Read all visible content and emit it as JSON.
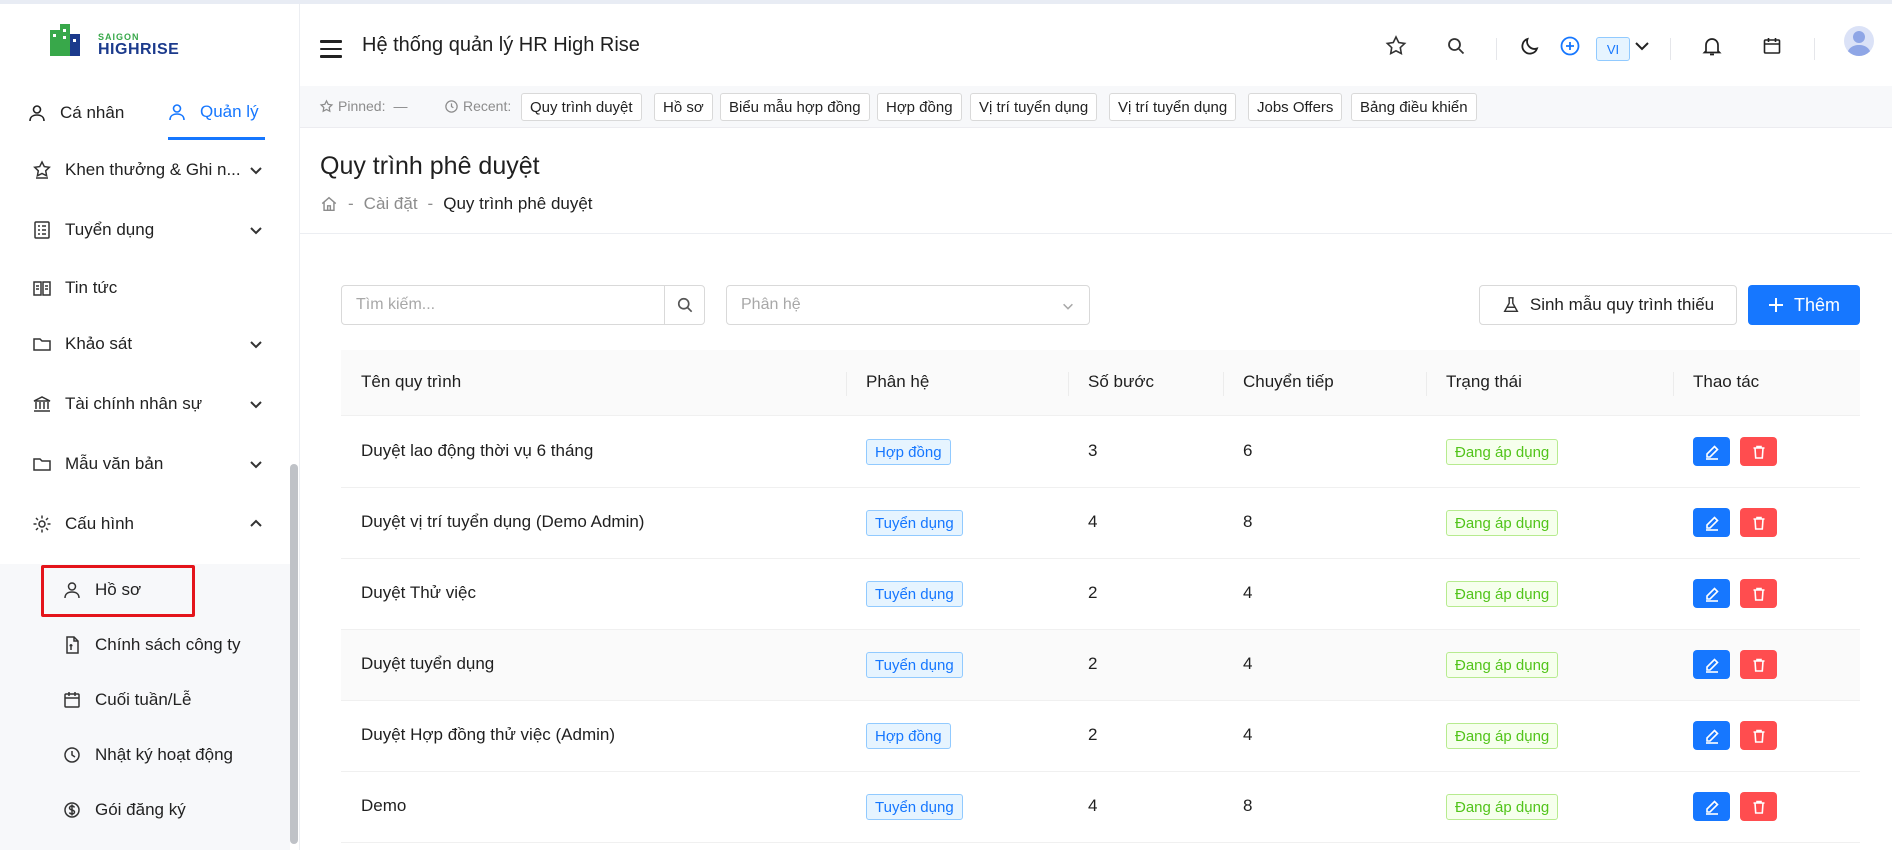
{
  "brand": {
    "top": "SAIGON",
    "main": "HIGHRISE"
  },
  "sidebar": {
    "tabs": [
      {
        "label": "Cá nhân"
      },
      {
        "label": "Quản lý"
      }
    ],
    "items": [
      {
        "label": "Khen thưởng & Ghi n...",
        "icon": "award-icon"
      },
      {
        "label": "Tuyển dụng",
        "icon": "list-icon"
      },
      {
        "label": "Tin tức",
        "icon": "news-icon"
      },
      {
        "label": "Khảo sát",
        "icon": "folder-icon"
      },
      {
        "label": "Tài chính nhân sự",
        "icon": "bank-icon"
      },
      {
        "label": "Mẫu văn bản",
        "icon": "folder-icon"
      },
      {
        "label": "Cấu hình",
        "icon": "gear-icon"
      }
    ],
    "subitems": [
      {
        "label": "Hồ sơ",
        "icon": "user-icon"
      },
      {
        "label": "Chính sách công ty",
        "icon": "document-icon"
      },
      {
        "label": "Cuối tuần/Lễ",
        "icon": "calendar-icon"
      },
      {
        "label": "Nhật ký hoạt động",
        "icon": "history-icon"
      },
      {
        "label": "Gói đăng ký",
        "icon": "dollar-icon"
      }
    ]
  },
  "header": {
    "title": "Hệ thống quản lý HR High Rise",
    "lang": "VI"
  },
  "pinbar": {
    "pinned_label": "Pinned:",
    "pinned_value": "—",
    "recent_label": "Recent:",
    "recent": [
      "Quy trình duyệt",
      "Hồ sơ",
      "Biểu mẫu hợp đồng",
      "Hợp đồng",
      "Vị trí tuyển dụng",
      "Vị trí tuyển dụng",
      "Jobs Offers",
      "Bảng điều khiển"
    ]
  },
  "page": {
    "title": "Quy trình phê duyệt",
    "breadcrumb": [
      "Cài đặt",
      "Quy trình phê duyệt"
    ]
  },
  "toolbar": {
    "search_placeholder": "Tìm kiếm...",
    "module_placeholder": "Phân hệ",
    "generate_label": "Sinh mẫu quy trình thiếu",
    "add_label": "Thêm"
  },
  "table": {
    "columns": [
      "Tên quy trình",
      "Phân hệ",
      "Số bước",
      "Chuyển tiếp",
      "Trạng thái",
      "Thao tác"
    ],
    "rows": [
      {
        "name": "Duyệt lao động thời vụ 6 tháng",
        "module": "Hợp đồng",
        "steps": "3",
        "transitions": "6",
        "status": "Đang áp dụng"
      },
      {
        "name": "Duyệt vị trí tuyển dụng (Demo Admin)",
        "module": "Tuyển dụng",
        "steps": "4",
        "transitions": "8",
        "status": "Đang áp dụng"
      },
      {
        "name": "Duyệt Thử việc",
        "module": "Tuyển dụng",
        "steps": "2",
        "transitions": "4",
        "status": "Đang áp dụng"
      },
      {
        "name": "Duyệt tuyển dụng",
        "module": "Tuyển dụng",
        "steps": "2",
        "transitions": "4",
        "status": "Đang áp dụng"
      },
      {
        "name": "Duyệt Hợp đồng thử việc (Admin)",
        "module": "Hợp đồng",
        "steps": "2",
        "transitions": "4",
        "status": "Đang áp dụng"
      },
      {
        "name": "Demo",
        "module": "Tuyển dụng",
        "steps": "4",
        "transitions": "8",
        "status": "Đang áp dụng"
      }
    ]
  },
  "colors": {
    "primary": "#1677ff",
    "danger": "#ff4d4f",
    "success": "#52c41a",
    "brand_green": "#38a84a",
    "brand_navy": "#1b3a8c"
  }
}
